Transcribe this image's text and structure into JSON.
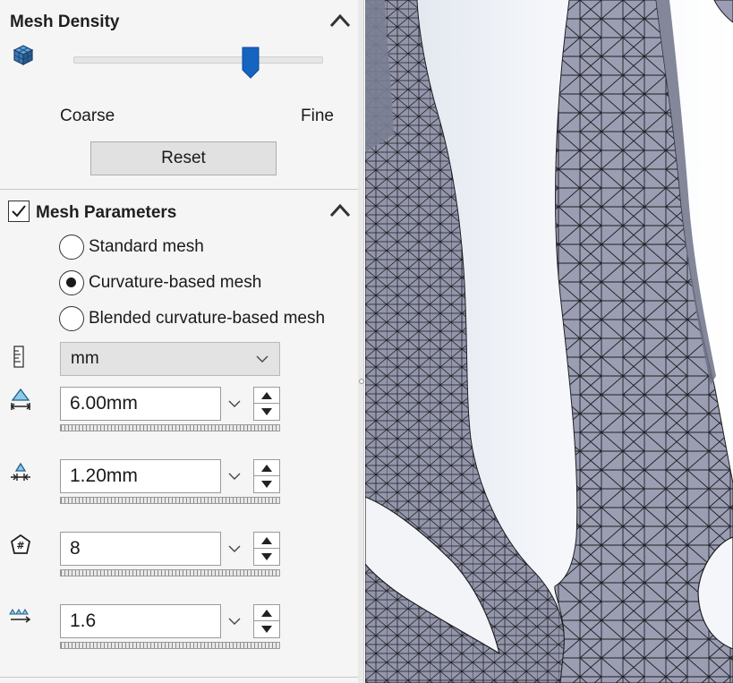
{
  "mesh_density": {
    "title": "Mesh Density",
    "coarse_label": "Coarse",
    "fine_label": "Fine",
    "reset_label": "Reset",
    "slider_value": 0.71,
    "icon": "mesh-cube-icon"
  },
  "mesh_parameters": {
    "title": "Mesh Parameters",
    "checked": true,
    "options": [
      {
        "label": "Standard mesh",
        "selected": false
      },
      {
        "label": "Curvature-based mesh",
        "selected": true
      },
      {
        "label": "Blended curvature-based mesh",
        "selected": false
      }
    ],
    "unit": {
      "value": "mm",
      "icon": "ruler-icon"
    },
    "fields": [
      {
        "value": "6.00mm",
        "icon": "max-element-size-icon"
      },
      {
        "value": "1.20mm",
        "icon": "min-element-size-icon"
      },
      {
        "value": "8",
        "icon": "min-elements-in-circle-icon"
      },
      {
        "value": "1.6",
        "icon": "growth-ratio-icon"
      }
    ]
  },
  "colors": {
    "accent": "#1565c0",
    "mesh_fill": "#9a9db2",
    "panel_bg": "#f5f5f5"
  }
}
